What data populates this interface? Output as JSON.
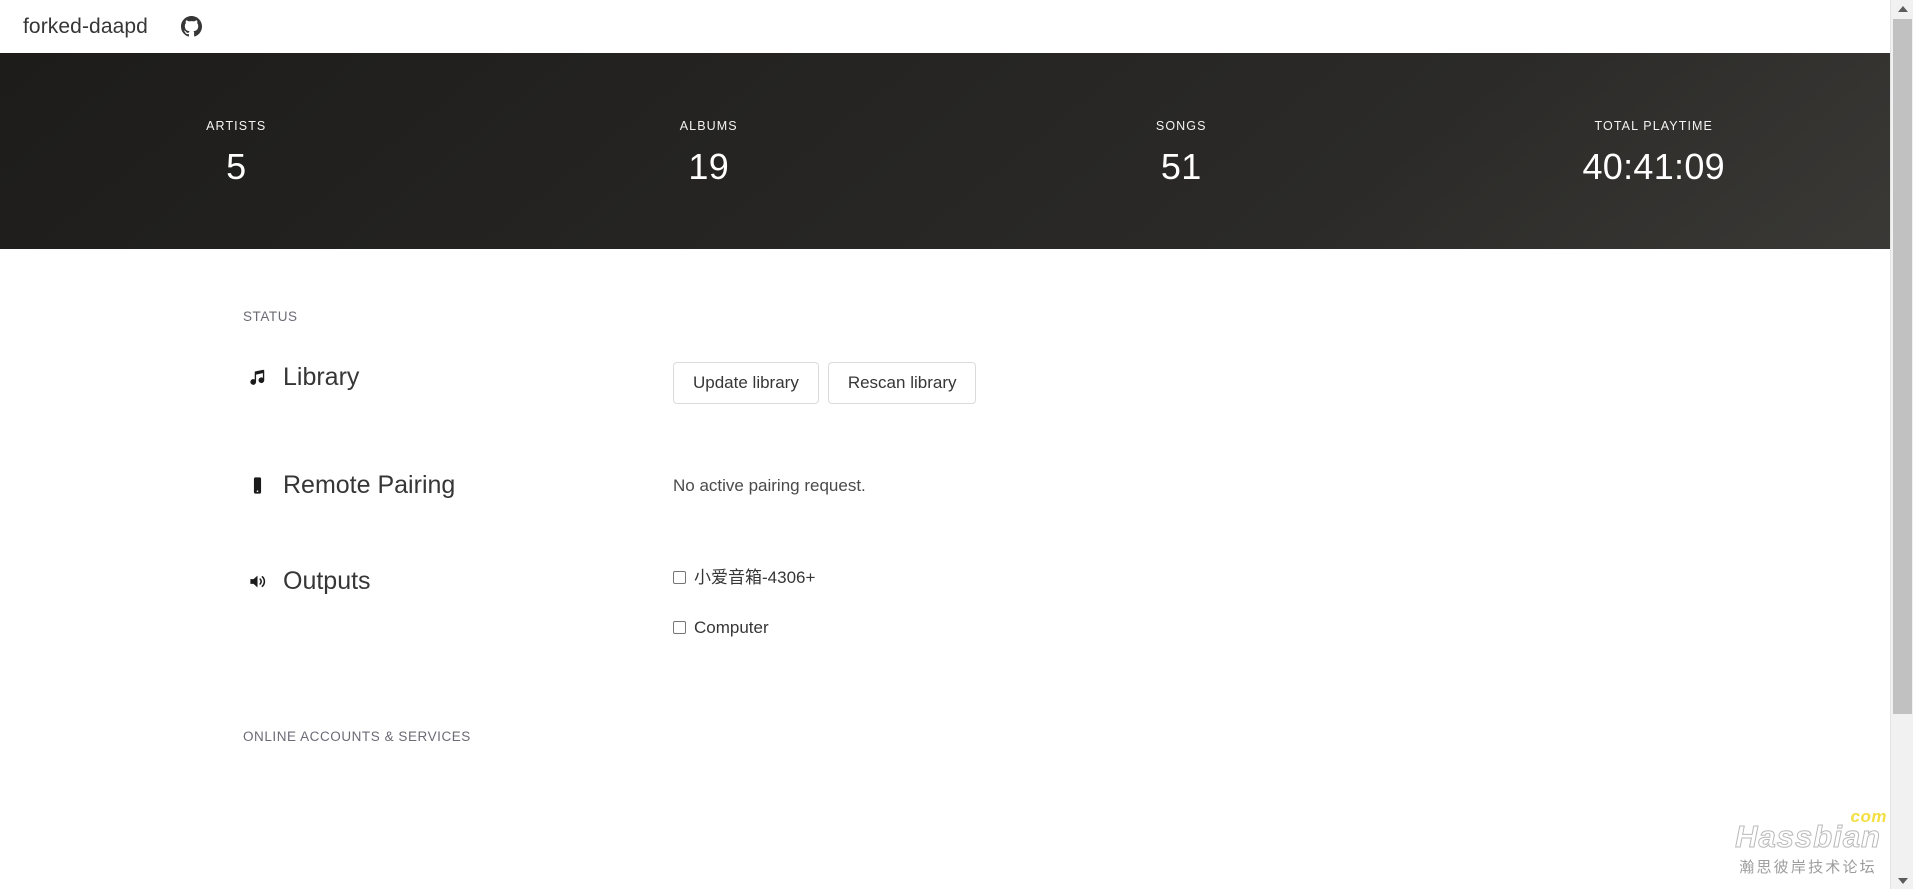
{
  "navbar": {
    "brand": "forked-daapd",
    "github_icon": "github-icon"
  },
  "hero": {
    "stats": [
      {
        "label": "ARTISTS",
        "value": "5"
      },
      {
        "label": "ALBUMS",
        "value": "19"
      },
      {
        "label": "SONGS",
        "value": "51"
      },
      {
        "label": "TOTAL PLAYTIME",
        "value": "40:41:09"
      }
    ]
  },
  "status_section": {
    "title": "STATUS",
    "library": {
      "label": "Library",
      "icon": "music-note-icon",
      "update_button": "Update library",
      "rescan_button": "Rescan library"
    },
    "remote_pairing": {
      "label": "Remote Pairing",
      "icon": "mobile-phone-icon",
      "message": "No active pairing request."
    },
    "outputs": {
      "label": "Outputs",
      "icon": "volume-up-icon",
      "devices": [
        {
          "name": "小爱音箱-4306+",
          "checked": false
        },
        {
          "name": "Computer",
          "checked": false
        }
      ]
    }
  },
  "online_section": {
    "title": "ONLINE ACCOUNTS & SERVICES"
  },
  "watermark": {
    "main": "Hassbian",
    "tld": "com",
    "subtitle": "瀚思彼岸技术论坛"
  },
  "scrollbar": {
    "up_icon": "caret-up-icon",
    "down_icon": "caret-down-icon"
  },
  "colors": {
    "hero_dark": "#1d1c1a",
    "hero_light": "#3a3936",
    "text_primary": "#363636",
    "text_muted": "#6b6b76",
    "border": "#dbdbdb",
    "watermark_yellow": "#f4df42"
  }
}
